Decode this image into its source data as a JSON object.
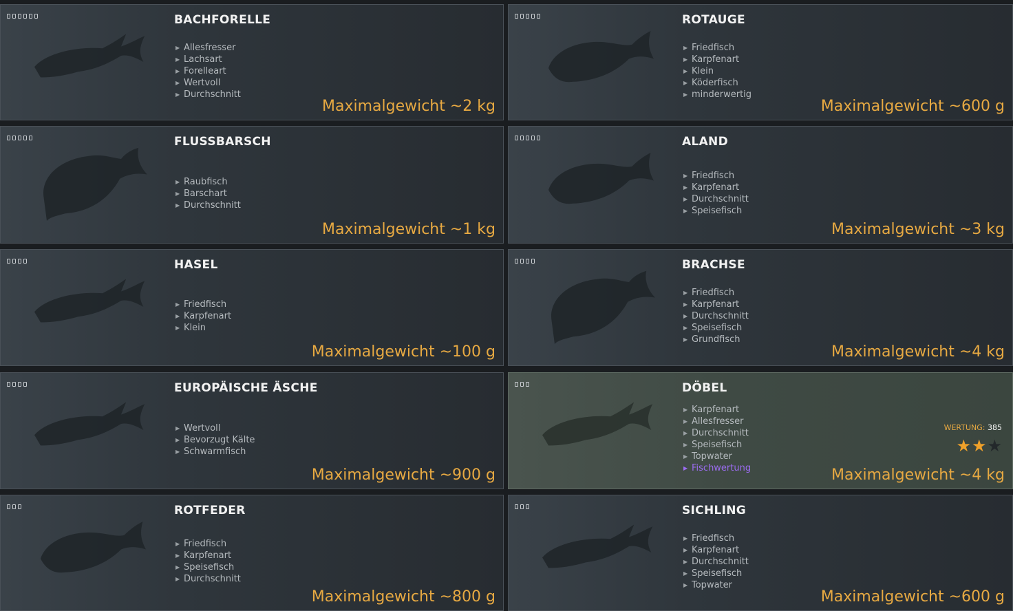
{
  "weight_prefix": "Maximalgewicht",
  "rating_label": "WERTUNG",
  "cards": [
    {
      "name": "BACHFORELLE",
      "dots": 6,
      "fish_icon": "trout-silhouette-icon",
      "tags": [
        "Allesfresser",
        "Lachsart",
        "Forelleart",
        "Wertvoll",
        "Durchschnitt"
      ],
      "weight": "Maximalgewicht ~2 kg"
    },
    {
      "name": "ROTAUGE",
      "dots": 5,
      "fish_icon": "roach-silhouette-icon",
      "tags": [
        "Friedfisch",
        "Karpfenart",
        "Klein",
        "Köderfisch",
        "minderwertig"
      ],
      "weight": "Maximalgewicht ~600 g"
    },
    {
      "name": "FLUSSBARSCH",
      "dots": 5,
      "fish_icon": "perch-silhouette-icon",
      "tags": [
        "Raubfisch",
        "Barschart",
        "Durchschnitt"
      ],
      "weight": "Maximalgewicht ~1 kg"
    },
    {
      "name": "ALAND",
      "dots": 5,
      "fish_icon": "ide-silhouette-icon",
      "tags": [
        "Friedfisch",
        "Karpfenart",
        "Durchschnitt",
        "Speisefisch"
      ],
      "weight": "Maximalgewicht ~3 kg"
    },
    {
      "name": "HASEL",
      "dots": 4,
      "fish_icon": "dace-silhouette-icon",
      "tags": [
        "Friedfisch",
        "Karpfenart",
        "Klein"
      ],
      "weight": "Maximalgewicht ~100 g"
    },
    {
      "name": "BRACHSE",
      "dots": 4,
      "fish_icon": "bream-silhouette-icon",
      "tags": [
        "Friedfisch",
        "Karpfenart",
        "Durchschnitt",
        "Speisefisch",
        "Grundfisch"
      ],
      "weight": "Maximalgewicht ~4 kg"
    },
    {
      "name": "EUROPÄISCHE ÄSCHE",
      "dots": 4,
      "fish_icon": "grayling-silhouette-icon",
      "tags": [
        "Wertvoll",
        "Bevorzugt Kälte",
        "Schwarmfisch"
      ],
      "weight": "Maximalgewicht ~900 g"
    },
    {
      "name": "DÖBEL",
      "dots": 3,
      "fish_icon": "chub-silhouette-icon",
      "selected": true,
      "tags": [
        "Karpfenart",
        "Allesfresser",
        "Durchschnitt",
        "Speisefisch",
        "Topwater"
      ],
      "special_tag": "Fischwertung",
      "rating": "385",
      "stars_filled": 2,
      "stars_total": 3,
      "weight": "Maximalgewicht ~4 kg"
    },
    {
      "name": "ROTFEDER",
      "dots": 3,
      "fish_icon": "rudd-silhouette-icon",
      "tags": [
        "Friedfisch",
        "Karpfenart",
        "Speisefisch",
        "Durchschnitt"
      ],
      "weight": "Maximalgewicht ~800 g"
    },
    {
      "name": "SICHLING",
      "dots": 3,
      "fish_icon": "sichel-silhouette-icon",
      "tags": [
        "Friedfisch",
        "Karpfenart",
        "Durchschnitt",
        "Speisefisch",
        "Topwater"
      ],
      "weight": "Maximalgewicht ~600 g"
    }
  ]
}
